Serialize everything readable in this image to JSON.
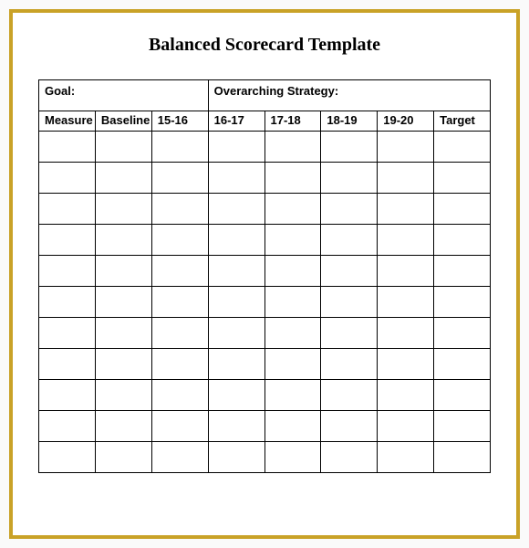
{
  "title": "Balanced Scorecard Template",
  "topRow": {
    "goalLabel": "Goal:",
    "goalValue": "",
    "strategyLabel": "Overarching Strategy:",
    "strategyValue": ""
  },
  "headers": {
    "measure": "Measure",
    "baseline": "Baseline",
    "y1": "15-16",
    "y2": "16-17",
    "y3": "17-18",
    "y4": "18-19",
    "y5": "19-20",
    "target": "Target"
  },
  "rows": [
    {
      "measure": "",
      "baseline": "",
      "y1": "",
      "y2": "",
      "y3": "",
      "y4": "",
      "y5": "",
      "target": ""
    },
    {
      "measure": "",
      "baseline": "",
      "y1": "",
      "y2": "",
      "y3": "",
      "y4": "",
      "y5": "",
      "target": ""
    },
    {
      "measure": "",
      "baseline": "",
      "y1": "",
      "y2": "",
      "y3": "",
      "y4": "",
      "y5": "",
      "target": ""
    },
    {
      "measure": "",
      "baseline": "",
      "y1": "",
      "y2": "",
      "y3": "",
      "y4": "",
      "y5": "",
      "target": ""
    },
    {
      "measure": "",
      "baseline": "",
      "y1": "",
      "y2": "",
      "y3": "",
      "y4": "",
      "y5": "",
      "target": ""
    },
    {
      "measure": "",
      "baseline": "",
      "y1": "",
      "y2": "",
      "y3": "",
      "y4": "",
      "y5": "",
      "target": ""
    },
    {
      "measure": "",
      "baseline": "",
      "y1": "",
      "y2": "",
      "y3": "",
      "y4": "",
      "y5": "",
      "target": ""
    },
    {
      "measure": "",
      "baseline": "",
      "y1": "",
      "y2": "",
      "y3": "",
      "y4": "",
      "y5": "",
      "target": ""
    },
    {
      "measure": "",
      "baseline": "",
      "y1": "",
      "y2": "",
      "y3": "",
      "y4": "",
      "y5": "",
      "target": ""
    },
    {
      "measure": "",
      "baseline": "",
      "y1": "",
      "y2": "",
      "y3": "",
      "y4": "",
      "y5": "",
      "target": ""
    },
    {
      "measure": "",
      "baseline": "",
      "y1": "",
      "y2": "",
      "y3": "",
      "y4": "",
      "y5": "",
      "target": ""
    }
  ]
}
